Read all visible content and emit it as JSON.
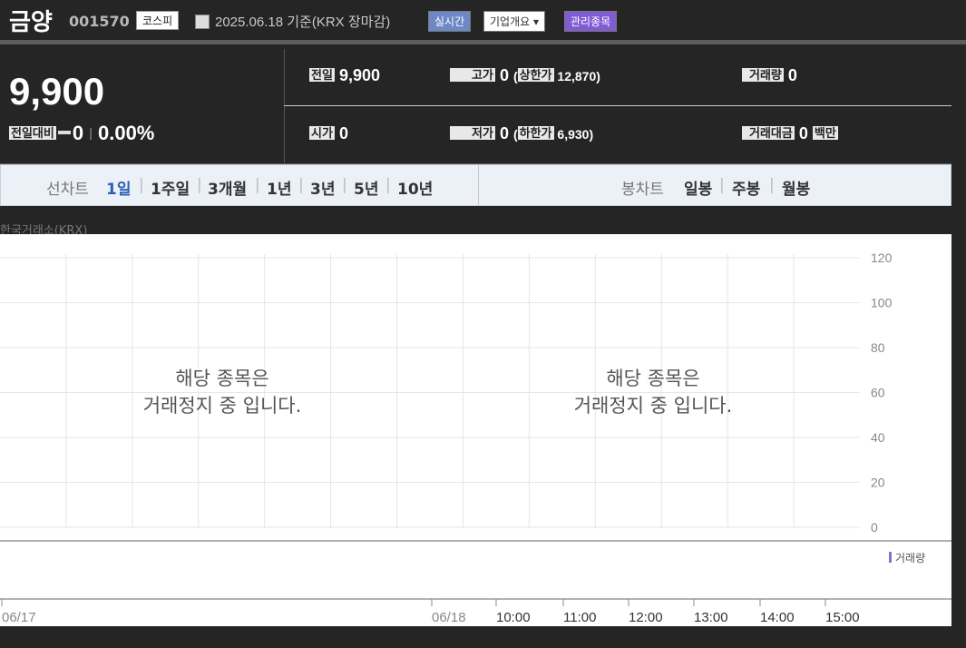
{
  "header": {
    "stock_name": "금양",
    "stock_code": "001570",
    "market": "코스피",
    "date_text": "2025.06.18 기준(KRX 장마감)",
    "buttons": [
      "실시간",
      "기업개요 ▾",
      "관리종목"
    ]
  },
  "quote": {
    "price": "9,900",
    "change_label": "전일대비",
    "change": "0",
    "change_pct": "0.00%",
    "prev_label": "전일",
    "prev": "9,900",
    "high_label": "고가",
    "high": "0",
    "upper_label": "상한가",
    "upper": "12,870",
    "volume_label": "거래량",
    "volume": "0",
    "open_label": "시가",
    "open": "0",
    "low_label": "저가",
    "low": "0",
    "lower_label": "하한가",
    "lower": "6,930",
    "value_label": "거래대금",
    "value": "0",
    "value_unit": "백만"
  },
  "tabs": {
    "line_label": "선차트",
    "line_periods": [
      "1일",
      "1주일",
      "3개월",
      "1년",
      "3년",
      "5년",
      "10년"
    ],
    "active": "1일",
    "candle_label": "봉차트",
    "candle_periods": [
      "일봉",
      "주봉",
      "월봉"
    ]
  },
  "chart": {
    "source": "한국거래소(KRX)",
    "message_line1": "해당 종목은",
    "message_line2": "거래정지 중 입니다.",
    "volume_legend": "거래량",
    "volume_legend_color": "#8a6fd0",
    "x_ticks": [
      "06/17",
      "06/18",
      "10:00",
      "11:00",
      "12:00",
      "13:00",
      "14:00",
      "15:00"
    ]
  },
  "chart_data": {
    "type": "line",
    "x": [
      "06/17",
      "06/18",
      "10:00",
      "11:00",
      "12:00",
      "13:00",
      "14:00",
      "15:00"
    ],
    "series": [],
    "y_ticks": [
      120,
      100,
      80,
      60,
      40,
      20,
      0
    ],
    "ylim": [
      0,
      120
    ],
    "grid": true
  }
}
